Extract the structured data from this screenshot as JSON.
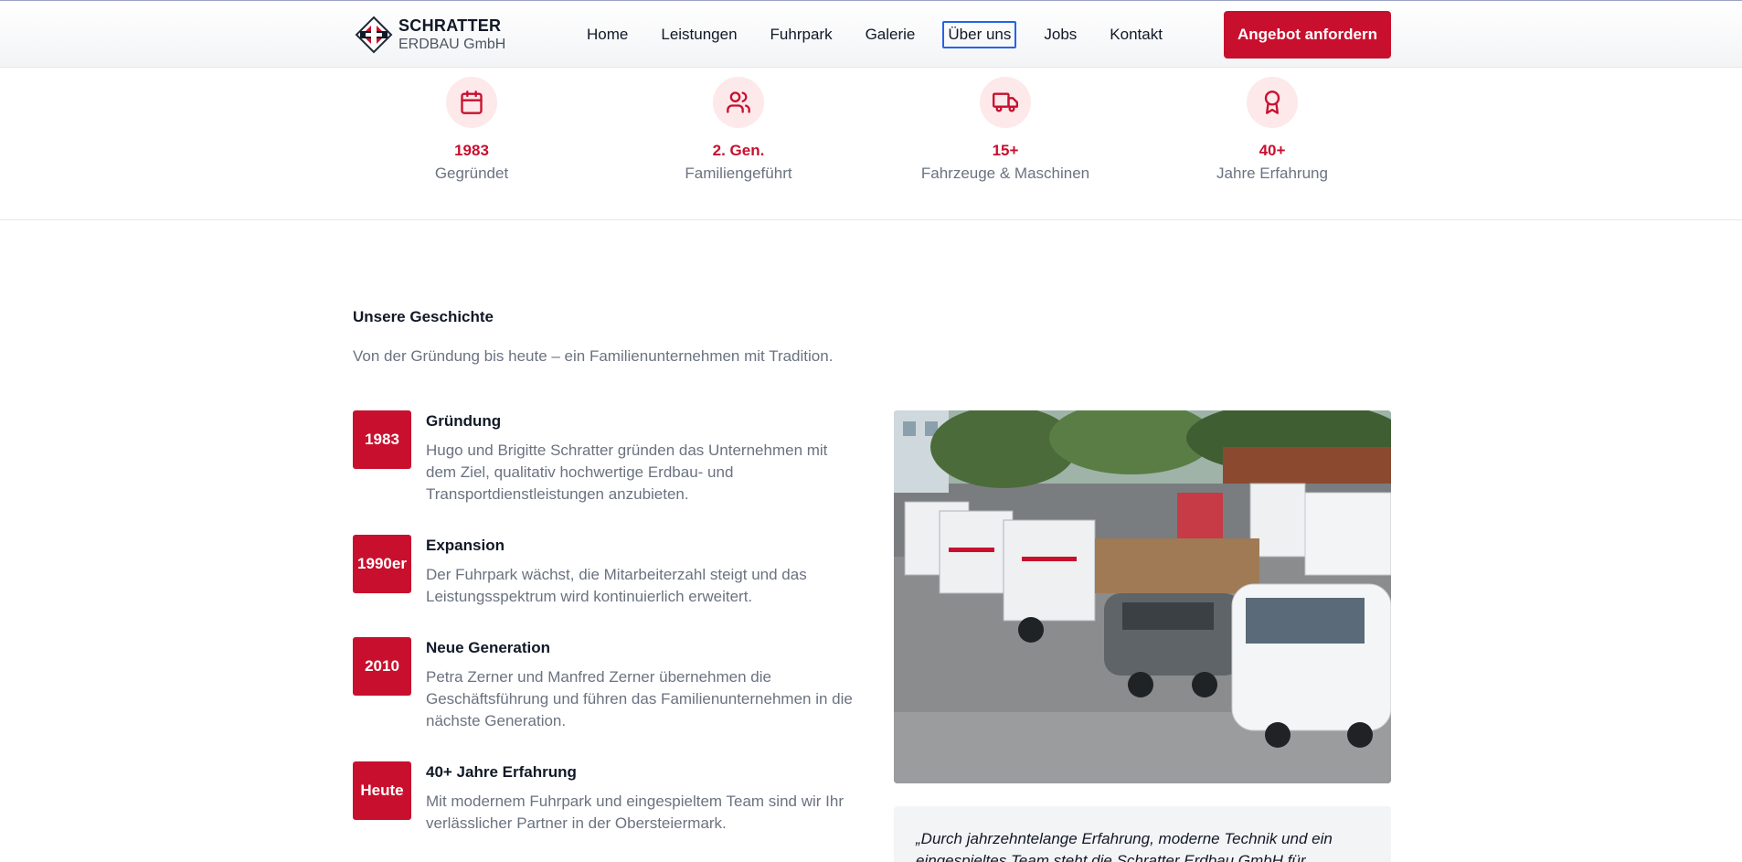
{
  "header": {
    "brand_name": "SCHRATTER",
    "brand_sub": "ERDBAU GmbH",
    "nav": [
      "Home",
      "Leistungen",
      "Fuhrpark",
      "Galerie",
      "Über uns",
      "Jobs",
      "Kontakt"
    ],
    "active_nav": "Über uns",
    "cta_label": "Angebot anfordern"
  },
  "stats": [
    {
      "icon": "calendar-icon",
      "value": "1983",
      "label": "Gegründet"
    },
    {
      "icon": "users-icon",
      "value": "2. Gen.",
      "label": "Familiengeführt"
    },
    {
      "icon": "truck-icon",
      "value": "15+",
      "label": "Fahrzeuge & Maschinen"
    },
    {
      "icon": "award-icon",
      "value": "40+",
      "label": "Jahre Erfahrung"
    }
  ],
  "history": {
    "title": "Unsere Geschichte",
    "subtitle": "Von der Gründung bis heute – ein Familienunternehmen mit Tradition.",
    "timeline": [
      {
        "year": "1983",
        "title": "Gründung",
        "text": "Hugo und Brigitte Schratter gründen das Unternehmen mit dem Ziel, qualitativ hochwertige Erdbau- und Transportdienstleistungen anzubieten."
      },
      {
        "year": "1990er",
        "title": "Expansion",
        "text": "Der Fuhrpark wächst, die Mitarbeiterzahl steigt und das Leistungsspektrum wird kontinuierlich erweitert."
      },
      {
        "year": "2010",
        "title": "Neue Generation",
        "text": "Petra Zerner und Manfred Zerner übernehmen die Geschäftsführung und führen das Familienunternehmen in die nächste Generation."
      },
      {
        "year": "Heute",
        "title": "40+ Jahre Erfahrung",
        "text": "Mit modernem Fuhrpark und eingespieltem Team sind wir Ihr verlässlicher Partner in der Obersteiermark."
      }
    ],
    "quote": "„Durch jahrzehntelange Erfahrung, moderne Technik und ein eingespieltes Team steht die Schratter Erdbau GmbH für"
  },
  "colors": {
    "brand_red": "#c8102e",
    "icon_bg": "#fde8ea",
    "muted_text": "#6b7280"
  }
}
